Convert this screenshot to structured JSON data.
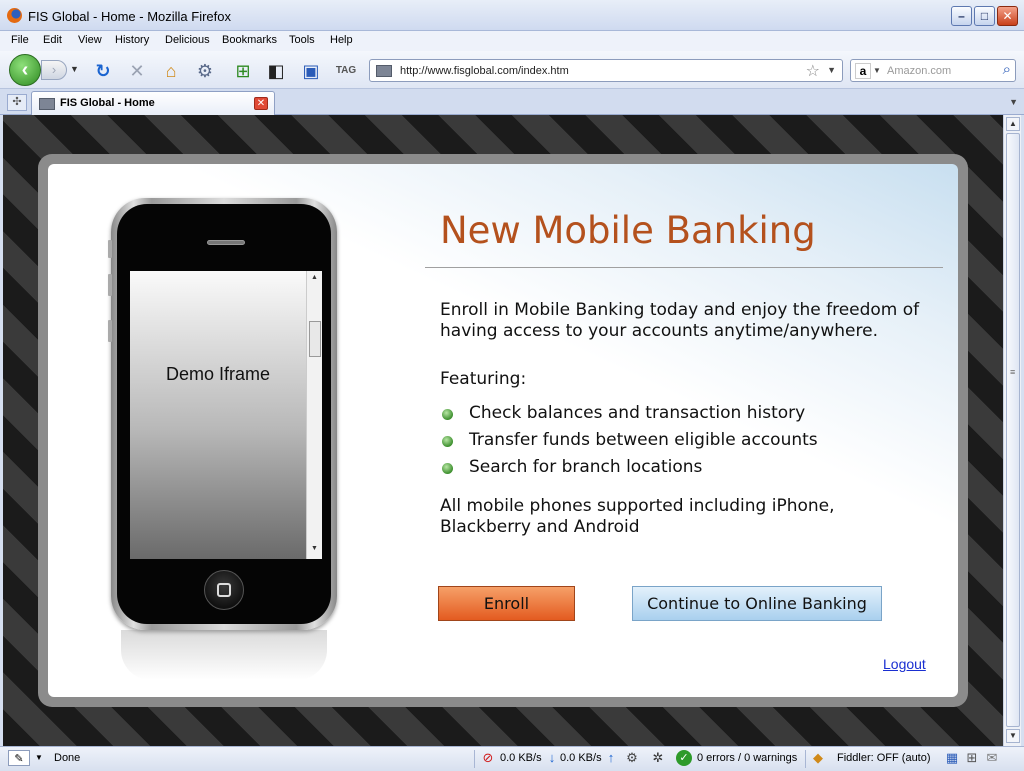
{
  "window": {
    "title": "FIS Global - Home - Mozilla Firefox"
  },
  "menu": [
    "File",
    "Edit",
    "View",
    "History",
    "Delicious",
    "Bookmarks",
    "Tools",
    "Help"
  ],
  "nav": {
    "url": "http://www.fisglobal.com/index.htm",
    "search_placeholder": "Amazon.com",
    "search_engine_letter": "a"
  },
  "tab": {
    "label": "FIS Global - Home"
  },
  "page": {
    "phone_screen_text": "Demo Iframe",
    "headline": "New Mobile Banking",
    "intro": "Enroll in Mobile Banking today and enjoy the freedom of having access to your accounts anytime/anywhere.",
    "featuring_label": "Featuring:",
    "features": [
      "Check balances and transaction history",
      "Transfer funds between eligible accounts",
      "Search for branch locations"
    ],
    "support": "All mobile phones supported including iPhone, Blackberry and Android",
    "enroll_label": "Enroll",
    "continue_label": "Continue to Online Banking",
    "logout_label": "Logout"
  },
  "status": {
    "text": "Done",
    "down_rate": "0.0 KB/s",
    "up_rate": "0.0 KB/s",
    "errors": "0 errors / 0 warnings",
    "fiddler": "Fiddler: OFF (auto)"
  },
  "colors": {
    "headline": "#b4511d",
    "enroll_button": "#e35b20",
    "continue_button": "#a9d0ee",
    "link": "#1a2fd1"
  }
}
